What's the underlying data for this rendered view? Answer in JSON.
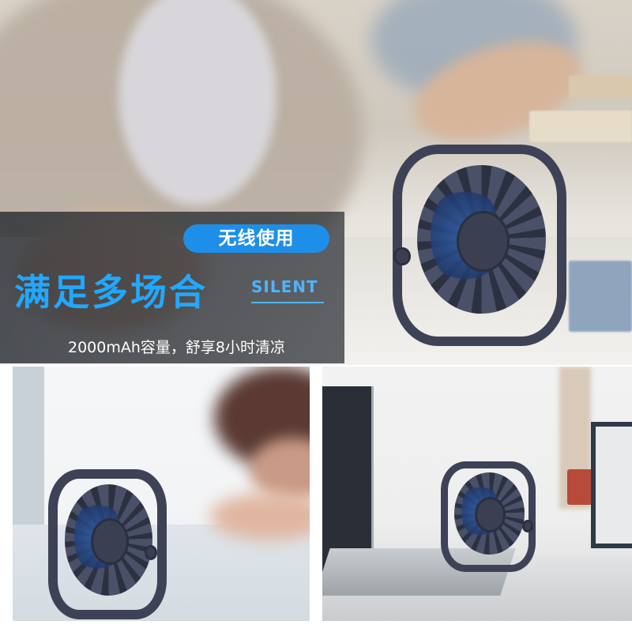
{
  "overlay": {
    "pill_text": "无线使用",
    "headline": "满足多场合",
    "tag": "SILENT",
    "subline": "2000mAh容量，舒享8小时清凉"
  },
  "colors": {
    "accent_blue": "#1e8fe8",
    "headline_blue": "#21a8ff",
    "band_dark": "#282c32",
    "fan_body": "#3e4257"
  },
  "photos": [
    {
      "name": "top-scene",
      "subject": "student at desk with fan"
    },
    {
      "name": "bottom-left-scene",
      "subject": "sleeping person with fan"
    },
    {
      "name": "bottom-right-scene",
      "subject": "laptop desk with fan"
    }
  ]
}
